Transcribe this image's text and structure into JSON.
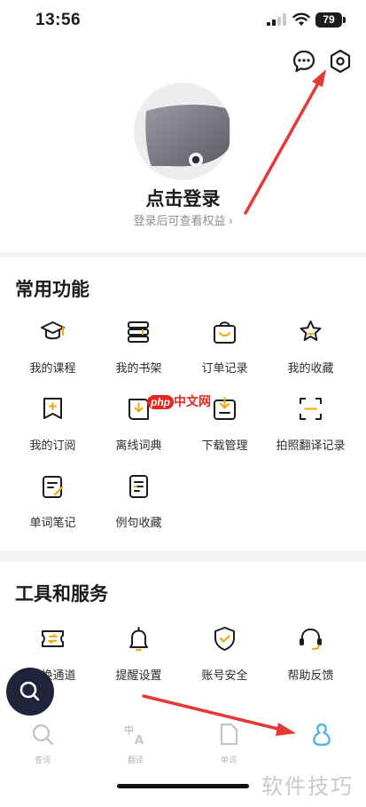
{
  "status": {
    "time": "13:56",
    "battery": "79"
  },
  "profile": {
    "login_title": "点击登录",
    "login_sub": "登录后可查看权益 ›"
  },
  "sections": {
    "common": {
      "title": "常用功能",
      "items": [
        {
          "label": "我的课程",
          "icon": "graduation-cap-icon"
        },
        {
          "label": "我的书架",
          "icon": "bookshelf-icon"
        },
        {
          "label": "订单记录",
          "icon": "shopping-bag-icon"
        },
        {
          "label": "我的收藏",
          "icon": "star-icon"
        },
        {
          "label": "我的订阅",
          "icon": "subscription-icon"
        },
        {
          "label": "离线词典",
          "icon": "offline-dictionary-icon"
        },
        {
          "label": "下载管理",
          "icon": "download-icon"
        },
        {
          "label": "拍照翻译记录",
          "icon": "scan-icon"
        },
        {
          "label": "单词笔记",
          "icon": "notes-icon"
        },
        {
          "label": "例句收藏",
          "icon": "sentence-collection-icon"
        }
      ]
    },
    "tools": {
      "title": "工具和服务",
      "items": [
        {
          "label": "兑换通道",
          "icon": "exchange-icon"
        },
        {
          "label": "提醒设置",
          "icon": "bell-icon"
        },
        {
          "label": "账号安全",
          "icon": "shield-icon"
        },
        {
          "label": "帮助反馈",
          "icon": "headset-icon"
        }
      ]
    }
  },
  "tabs": [
    {
      "label": "查词",
      "icon": "search-icon"
    },
    {
      "label": "翻译",
      "icon": "translate-icon"
    },
    {
      "label": "单词",
      "icon": "document-icon"
    },
    {
      "label": "",
      "icon": "profile-icon"
    }
  ],
  "watermark": {
    "pill": "php",
    "text": "中文网"
  },
  "corner_mark": "软件技巧",
  "colors": {
    "accent": "#f6a800",
    "active_tab": "#4fb6e8",
    "arrow": "#e53935"
  }
}
